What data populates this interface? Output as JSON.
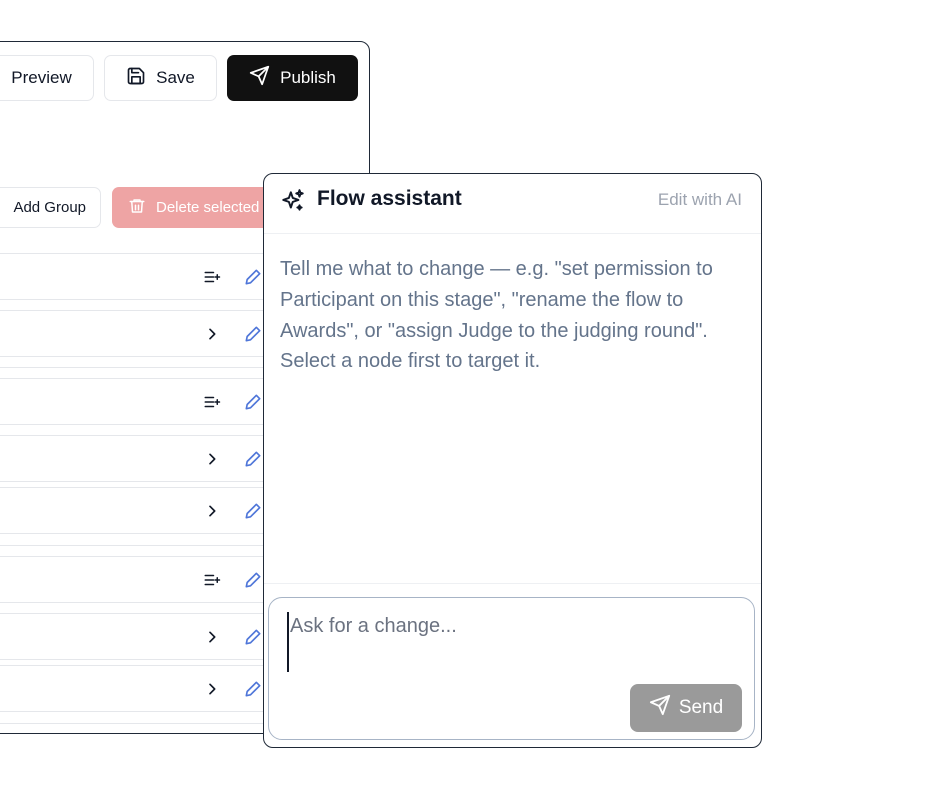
{
  "toolbar": {
    "preview_label": "Preview",
    "save_label": "Save",
    "publish_label": "Publish"
  },
  "actions": {
    "add_group_label": "Add Group",
    "delete_selected_label": "Delete selected"
  },
  "assistant": {
    "title": "Flow assistant",
    "subtitle": "Edit with AI",
    "hint": "Tell me what to change — e.g. \"set permission to Participant on this stage\", \"rename the flow to Awards\", or \"assign Judge to the judging round\". Select a node first to target it.",
    "input_placeholder": "Ask for a change...",
    "input_value": "",
    "send_label": "Send"
  },
  "icons": {
    "preview": "eye-icon",
    "save": "floppy-disk-icon",
    "publish": "send-icon",
    "delete": "trash-icon",
    "assistant": "sparkles-icon",
    "send": "send-icon",
    "group_row_lead": "list-add-icon",
    "stage_row_lead": "chevron-right-icon",
    "row_edit": "pencil-icon"
  },
  "colors": {
    "publish_bg": "#111111",
    "delete_bg": "#eea4a4",
    "edit_icon": "#4f76d9",
    "hint_text": "#64748b",
    "send_bg": "#9a9a9a"
  }
}
